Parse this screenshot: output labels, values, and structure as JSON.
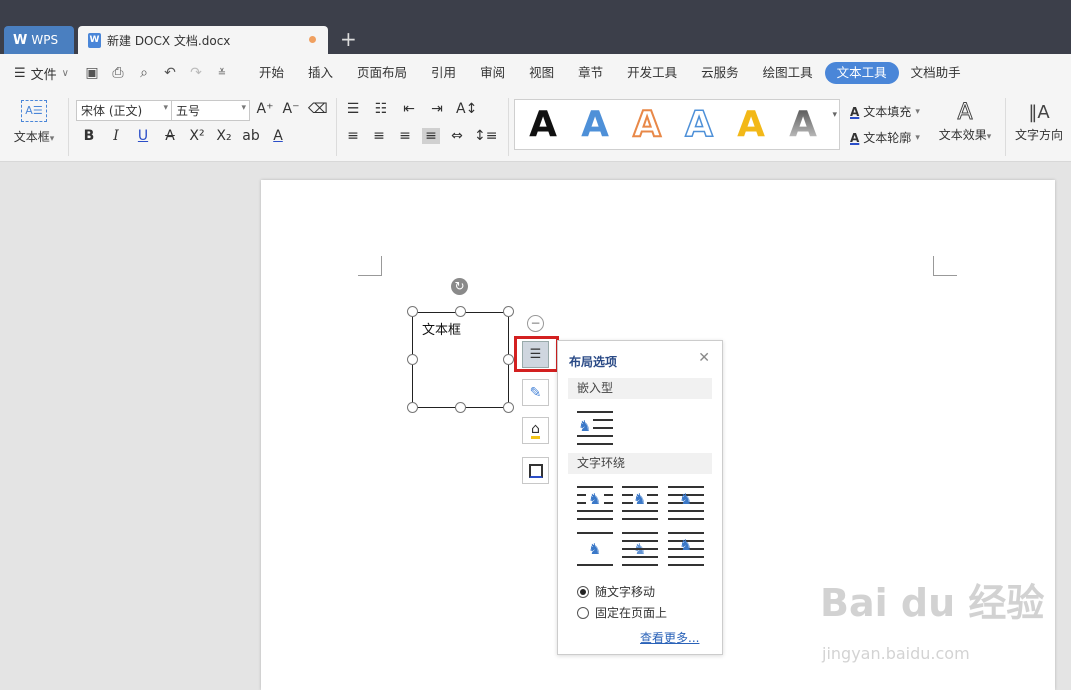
{
  "tabs": {
    "wps_label": "WPS",
    "doc_label": "新建 DOCX 文档.docx",
    "add_label": "+"
  },
  "menu": {
    "file_label": "文件",
    "items": [
      "开始",
      "插入",
      "页面布局",
      "引用",
      "审阅",
      "视图",
      "章节",
      "开发工具",
      "云服务",
      "绘图工具",
      "文本工具",
      "文档助手"
    ],
    "active": "文本工具"
  },
  "ribbon": {
    "textbox_label": "文本框",
    "font_name": "宋体 (正文)",
    "font_size": "五号",
    "gallery_letter": "A",
    "text_fill_label": "文本填充",
    "text_outline_label": "文本轮廓",
    "text_effect_label": "文本效果",
    "text_direction_label": "文字方向"
  },
  "document": {
    "textbox_text": "文本框"
  },
  "layout_popup": {
    "title": "布局选项",
    "inline_heading": "嵌入型",
    "wrap_heading": "文字环绕",
    "option_move": "随文字移动",
    "option_fixed": "固定在页面上",
    "selected": "随文字移动",
    "more_link": "查看更多..."
  },
  "watermark": {
    "logo_text": "Bai du 经验",
    "url": "jingyan.baidu.com"
  },
  "colors": {
    "accent": "#4a86d8",
    "titlebar": "#3c3f4a",
    "highlight": "#d32020"
  }
}
